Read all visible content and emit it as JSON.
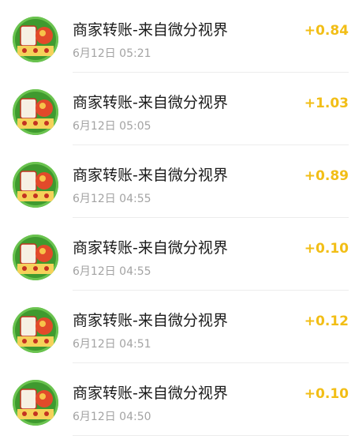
{
  "colors": {
    "amount": "#f2be16",
    "title": "#1b1b1b",
    "time": "#a3a3a3",
    "divider": "#ececec",
    "avatar_bg": "#6ac34f"
  },
  "transactions": [
    {
      "title": "商家转账-来自微分视界",
      "time": "6月12日 05:21",
      "amount": "+0.84",
      "avatar_icon": "game-logo-icon"
    },
    {
      "title": "商家转账-来自微分视界",
      "time": "6月12日 05:05",
      "amount": "+1.03",
      "avatar_icon": "game-logo-icon"
    },
    {
      "title": "商家转账-来自微分视界",
      "time": "6月12日 04:55",
      "amount": "+0.89",
      "avatar_icon": "game-logo-icon"
    },
    {
      "title": "商家转账-来自微分视界",
      "time": "6月12日 04:55",
      "amount": "+0.10",
      "avatar_icon": "game-logo-icon"
    },
    {
      "title": "商家转账-来自微分视界",
      "time": "6月12日 04:51",
      "amount": "+0.12",
      "avatar_icon": "game-logo-icon"
    },
    {
      "title": "商家转账-来自微分视界",
      "time": "6月12日 04:50",
      "amount": "+0.10",
      "avatar_icon": "game-logo-icon"
    }
  ]
}
